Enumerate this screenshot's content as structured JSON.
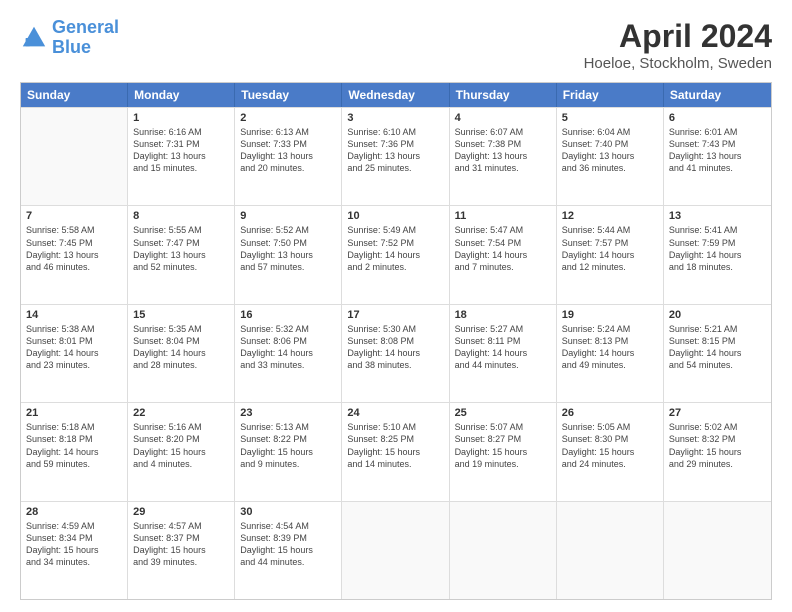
{
  "header": {
    "logo_line1": "General",
    "logo_line2": "Blue",
    "title": "April 2024",
    "subtitle": "Hoeloe, Stockholm, Sweden"
  },
  "weekdays": [
    "Sunday",
    "Monday",
    "Tuesday",
    "Wednesday",
    "Thursday",
    "Friday",
    "Saturday"
  ],
  "rows": [
    [
      {
        "day": "",
        "empty": true
      },
      {
        "day": "1",
        "sunrise": "6:16 AM",
        "sunset": "7:31 PM",
        "daylight": "13 hours and 15 minutes."
      },
      {
        "day": "2",
        "sunrise": "6:13 AM",
        "sunset": "7:33 PM",
        "daylight": "13 hours and 20 minutes."
      },
      {
        "day": "3",
        "sunrise": "6:10 AM",
        "sunset": "7:36 PM",
        "daylight": "13 hours and 25 minutes."
      },
      {
        "day": "4",
        "sunrise": "6:07 AM",
        "sunset": "7:38 PM",
        "daylight": "13 hours and 31 minutes."
      },
      {
        "day": "5",
        "sunrise": "6:04 AM",
        "sunset": "7:40 PM",
        "daylight": "13 hours and 36 minutes."
      },
      {
        "day": "6",
        "sunrise": "6:01 AM",
        "sunset": "7:43 PM",
        "daylight": "13 hours and 41 minutes."
      }
    ],
    [
      {
        "day": "7",
        "sunrise": "5:58 AM",
        "sunset": "7:45 PM",
        "daylight": "13 hours and 46 minutes."
      },
      {
        "day": "8",
        "sunrise": "5:55 AM",
        "sunset": "7:47 PM",
        "daylight": "13 hours and 52 minutes."
      },
      {
        "day": "9",
        "sunrise": "5:52 AM",
        "sunset": "7:50 PM",
        "daylight": "13 hours and 57 minutes."
      },
      {
        "day": "10",
        "sunrise": "5:49 AM",
        "sunset": "7:52 PM",
        "daylight": "14 hours and 2 minutes."
      },
      {
        "day": "11",
        "sunrise": "5:47 AM",
        "sunset": "7:54 PM",
        "daylight": "14 hours and 7 minutes."
      },
      {
        "day": "12",
        "sunrise": "5:44 AM",
        "sunset": "7:57 PM",
        "daylight": "14 hours and 12 minutes."
      },
      {
        "day": "13",
        "sunrise": "5:41 AM",
        "sunset": "7:59 PM",
        "daylight": "14 hours and 18 minutes."
      }
    ],
    [
      {
        "day": "14",
        "sunrise": "5:38 AM",
        "sunset": "8:01 PM",
        "daylight": "14 hours and 23 minutes."
      },
      {
        "day": "15",
        "sunrise": "5:35 AM",
        "sunset": "8:04 PM",
        "daylight": "14 hours and 28 minutes."
      },
      {
        "day": "16",
        "sunrise": "5:32 AM",
        "sunset": "8:06 PM",
        "daylight": "14 hours and 33 minutes."
      },
      {
        "day": "17",
        "sunrise": "5:30 AM",
        "sunset": "8:08 PM",
        "daylight": "14 hours and 38 minutes."
      },
      {
        "day": "18",
        "sunrise": "5:27 AM",
        "sunset": "8:11 PM",
        "daylight": "14 hours and 44 minutes."
      },
      {
        "day": "19",
        "sunrise": "5:24 AM",
        "sunset": "8:13 PM",
        "daylight": "14 hours and 49 minutes."
      },
      {
        "day": "20",
        "sunrise": "5:21 AM",
        "sunset": "8:15 PM",
        "daylight": "14 hours and 54 minutes."
      }
    ],
    [
      {
        "day": "21",
        "sunrise": "5:18 AM",
        "sunset": "8:18 PM",
        "daylight": "14 hours and 59 minutes."
      },
      {
        "day": "22",
        "sunrise": "5:16 AM",
        "sunset": "8:20 PM",
        "daylight": "15 hours and 4 minutes."
      },
      {
        "day": "23",
        "sunrise": "5:13 AM",
        "sunset": "8:22 PM",
        "daylight": "15 hours and 9 minutes."
      },
      {
        "day": "24",
        "sunrise": "5:10 AM",
        "sunset": "8:25 PM",
        "daylight": "15 hours and 14 minutes."
      },
      {
        "day": "25",
        "sunrise": "5:07 AM",
        "sunset": "8:27 PM",
        "daylight": "15 hours and 19 minutes."
      },
      {
        "day": "26",
        "sunrise": "5:05 AM",
        "sunset": "8:30 PM",
        "daylight": "15 hours and 24 minutes."
      },
      {
        "day": "27",
        "sunrise": "5:02 AM",
        "sunset": "8:32 PM",
        "daylight": "15 hours and 29 minutes."
      }
    ],
    [
      {
        "day": "28",
        "sunrise": "4:59 AM",
        "sunset": "8:34 PM",
        "daylight": "15 hours and 34 minutes."
      },
      {
        "day": "29",
        "sunrise": "4:57 AM",
        "sunset": "8:37 PM",
        "daylight": "15 hours and 39 minutes."
      },
      {
        "day": "30",
        "sunrise": "4:54 AM",
        "sunset": "8:39 PM",
        "daylight": "15 hours and 44 minutes."
      },
      {
        "day": "",
        "empty": true
      },
      {
        "day": "",
        "empty": true
      },
      {
        "day": "",
        "empty": true
      },
      {
        "day": "",
        "empty": true
      }
    ]
  ],
  "labels": {
    "sunrise": "Sunrise:",
    "sunset": "Sunset:",
    "daylight": "Daylight hours"
  }
}
